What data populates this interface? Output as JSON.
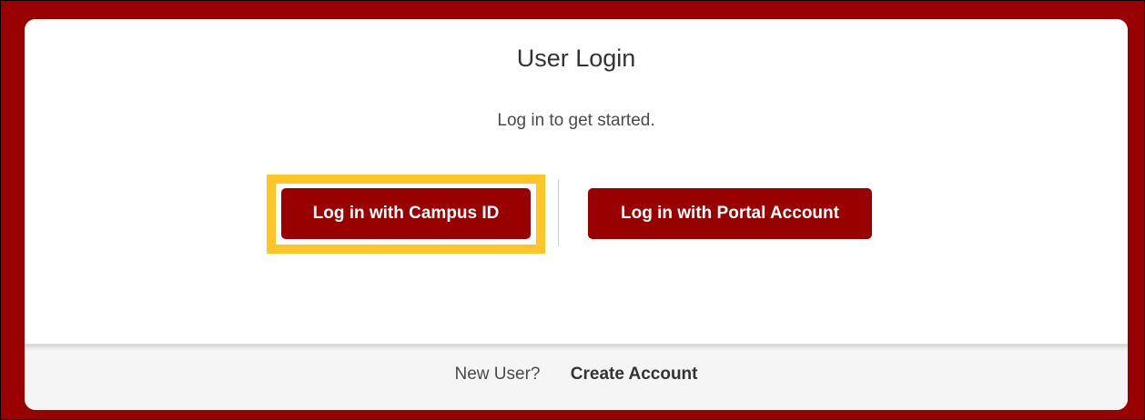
{
  "login": {
    "title": "User Login",
    "subtitle": "Log in to get started.",
    "campus_button_label": "Log in with Campus ID",
    "portal_button_label": "Log in with Portal Account"
  },
  "footer": {
    "new_user_text": "New User?",
    "create_account_label": "Create Account"
  },
  "colors": {
    "brand": "#990000",
    "highlight": "#ffc524",
    "footer_bg": "#f5f5f5"
  }
}
